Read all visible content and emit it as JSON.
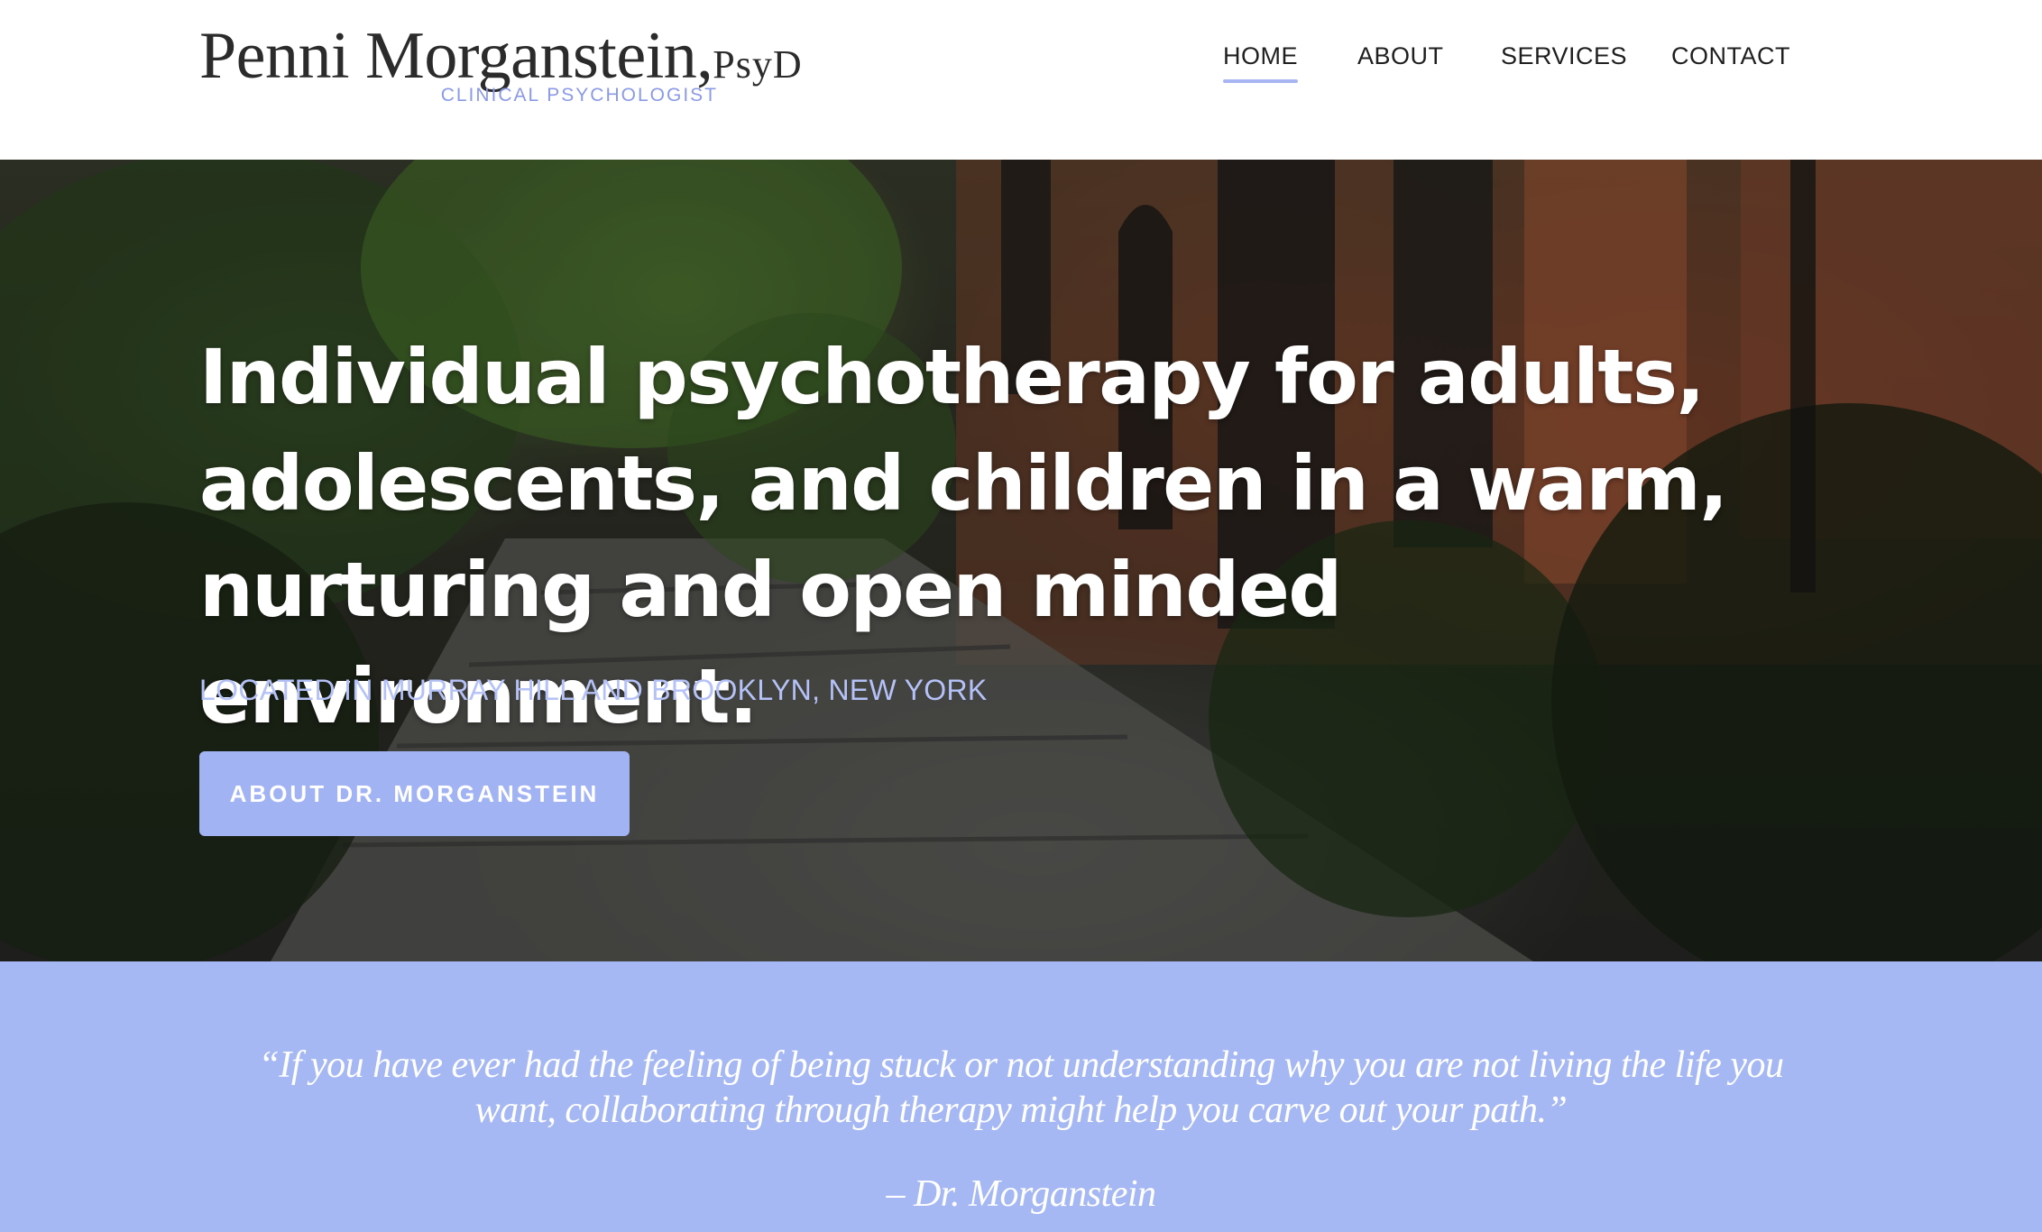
{
  "logo": {
    "name": "Penni Morganstein,",
    "suffix": "PsyD",
    "tagline": "CLINICAL PSYCHOLOGIST"
  },
  "nav": {
    "items": [
      {
        "label": "HOME",
        "active": true
      },
      {
        "label": "ABOUT",
        "active": false
      },
      {
        "label": "SERVICES",
        "active": false
      },
      {
        "label": "CONTACT",
        "active": false
      }
    ]
  },
  "hero": {
    "headline_lines": [
      "Individual psychotherapy for adults,",
      "adolescents, and children in a warm,",
      "nurturing and open minded environment."
    ],
    "location": "LOCATED IN MURRAY HILL AND BROOKLYN, NEW YORK",
    "cta_label": "ABOUT DR. MORGANSTEIN"
  },
  "quote": {
    "text": "“If you have ever had the feeling of being stuck or not understanding why you are not living the life you want, collaborating through therapy might help you carve out your path.”",
    "author": "– Dr. Morganstein"
  },
  "colors": {
    "accent": "#a2b3f4",
    "quote_band": "#a6b8f3",
    "tagline": "#8b9ae8",
    "location_text": "#b5c2f8"
  }
}
